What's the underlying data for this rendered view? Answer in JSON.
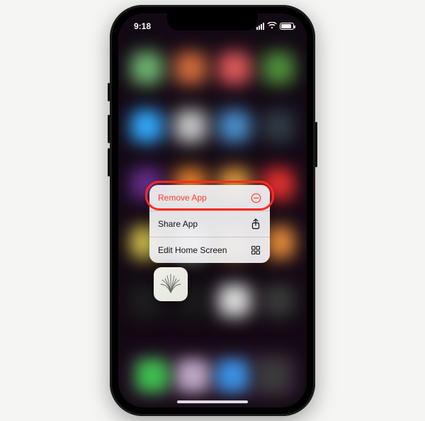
{
  "statusbar": {
    "time": "9:18"
  },
  "context_menu": {
    "items": [
      {
        "label": "Remove App",
        "icon": "remove-circle-icon",
        "destructive": true
      },
      {
        "label": "Share App",
        "icon": "share-icon",
        "destructive": false
      },
      {
        "label": "Edit Home Screen",
        "icon": "edit-home-icon",
        "destructive": false
      }
    ]
  },
  "highlight": {
    "target": "remove-app-menu-item"
  },
  "blur_colors": [
    "#6fb36f",
    "#cf6b3d",
    "#df5a5a",
    "#4f8f3b",
    "#33aaff",
    "#c4c4c4",
    "#4a8ec9",
    "#2f3b44",
    "#662f8b",
    "#e3852e",
    "#e19d3c",
    "#e33131",
    "#d9c64e",
    "#ffffff",
    "#eb9a51",
    "#e98e3d",
    "#1f1f1f",
    "#1c1c1c",
    "#dddddd",
    "#3a3a3a"
  ],
  "dock_colors": [
    "#3ebd4f",
    "#bba5c4",
    "#3a8fe0",
    "#3b3b3b"
  ]
}
